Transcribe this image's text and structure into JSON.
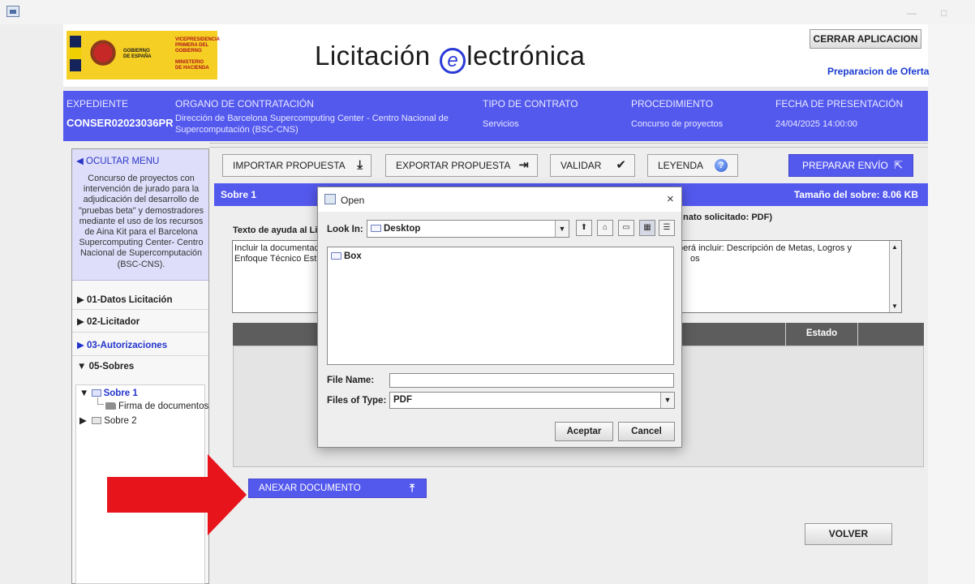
{
  "window": {
    "minimize": "—",
    "maximize": "□"
  },
  "header": {
    "logo": {
      "gov_line1": "GOBIERNO",
      "gov_line2": "DE ESPAÑA",
      "vice_line1": "VICEPRESIDENCIA",
      "vice_line2": "PRIMERA DEL GOBIERNO",
      "min_line1": "MINISTERIO",
      "min_line2": "DE HACIENDA"
    },
    "title_before": "Licitación",
    "title_e": "e",
    "title_after": "lectrónica",
    "close_app": "CERRAR APLICACION",
    "mode_link": "Preparacion de Oferta"
  },
  "info": {
    "expediente_h": "EXPEDIENTE",
    "expediente_v": "CONSER02023036PR",
    "organo_h": "ORGANO DE CONTRATACIÓN",
    "organo_v1": "Dirección de Barcelona Supercomputing Center - Centro Nacional de",
    "organo_v2": "Supercomputación (BSC-CNS)",
    "tipo_h": "TIPO DE CONTRATO",
    "tipo_v": "Servicios",
    "proc_h": "PROCEDIMIENTO",
    "proc_v": "Concurso de proyectos",
    "fecha_h": "FECHA DE PRESENTACIÓN",
    "fecha_v": "24/04/2025 14:00:00"
  },
  "sidebar": {
    "hide_menu": "◀  OCULTAR MENU",
    "description": "Concurso de proyectos con intervención de jurado para la adjudicación del desarrollo de \"pruebas beta\" y demostradores mediante el uso de los recursos de Aina Kit para el Barcelona Supercomputing Center- Centro Nacional de Supercomputación (BSC-CNS).",
    "items": [
      {
        "label": "▶  01-Datos Licitación"
      },
      {
        "label": "▶  02-Licitador"
      },
      {
        "label": "▶  03-Autorizaciones"
      },
      {
        "label": "▼  05-Sobres"
      }
    ],
    "tree": {
      "sobre1": "Sobre 1",
      "firma": "Firma de documentos",
      "sobre2": "Sobre 2"
    }
  },
  "toolbar": {
    "import": "IMPORTAR PROPUESTA",
    "export": "EXPORTAR PROPUESTA",
    "validate": "VALIDAR",
    "legend": "LEYENDA",
    "prepare": "PREPARAR ENVÍO"
  },
  "sobre": {
    "title": "Sobre 1",
    "size": "Tamaño del sobre: 8.06 KB",
    "help_label": "Texto de ayuda al Lic",
    "format_label": "nato solicitado: PDF)",
    "text_line1_a": "Incluir la documentac",
    "text_line1_b": "berá incluir: Descripción de Metas, Logros y",
    "text_line2_a": "Enfoque Técnico Est",
    "text_line2_b": "os",
    "col_estado": "Estado",
    "attach": "ANEXAR DOCUMENTO",
    "back": "VOLVER"
  },
  "dialog": {
    "title": "Open",
    "look_in_label": "Look In:",
    "look_in_value": "Desktop",
    "files": [
      "Box"
    ],
    "file_name_label": "File Name:",
    "file_name_value": "",
    "file_type_label": "Files of Type:",
    "file_type_value": "PDF",
    "accept": "Aceptar",
    "cancel": "Cancel"
  },
  "colors": {
    "accent": "#5459ee",
    "logo_yellow": "#f5cf24",
    "arrow_red": "#e8141c"
  }
}
